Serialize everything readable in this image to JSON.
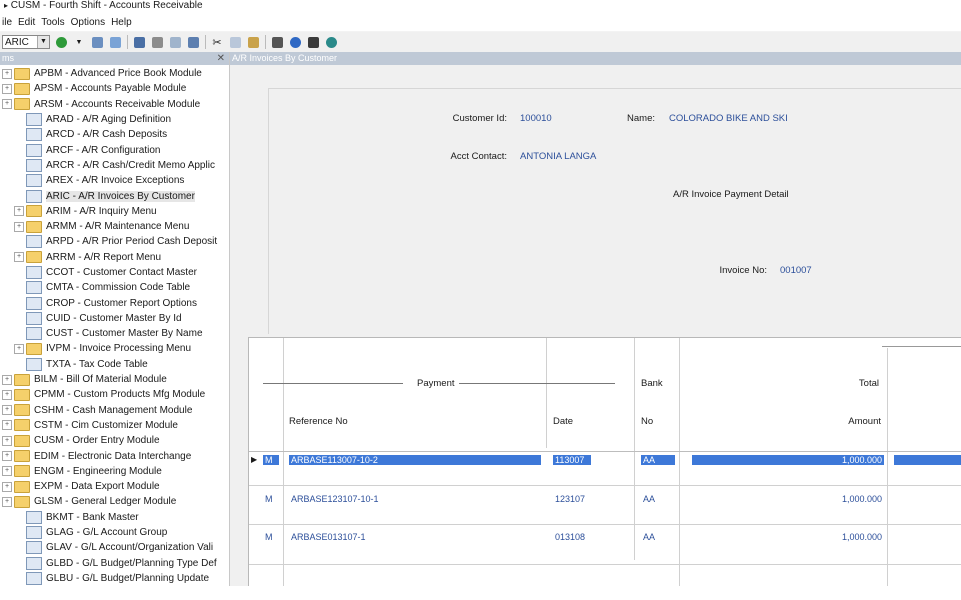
{
  "window": {
    "title": "CUSM - Fourth Shift - Accounts Receivable"
  },
  "menu": [
    "ile",
    "Edit",
    "Tools",
    "Options",
    "Help"
  ],
  "toolbar": {
    "combo_value": "ARIC"
  },
  "nav": {
    "header": "ms",
    "items": [
      {
        "label": "APBM - Advanced Price Book Module",
        "type": "folder",
        "level": 0
      },
      {
        "label": "APSM - Accounts Payable Module",
        "type": "folder",
        "level": 0
      },
      {
        "label": "ARSM - Accounts Receivable Module",
        "type": "folder",
        "level": 0
      },
      {
        "label": "ARAD - A/R Aging Definition",
        "type": "doc",
        "level": 1
      },
      {
        "label": "ARCD - A/R Cash Deposits",
        "type": "doc",
        "level": 1
      },
      {
        "label": "ARCF - A/R Configuration",
        "type": "doc",
        "level": 1
      },
      {
        "label": "ARCR - A/R Cash/Credit Memo Applic",
        "type": "doc",
        "level": 1
      },
      {
        "label": "AREX - A/R Invoice Exceptions",
        "type": "doc",
        "level": 1
      },
      {
        "label": "ARIC - A/R Invoices By Customer",
        "type": "doc",
        "level": 1,
        "selected": true
      },
      {
        "label": "ARIM - A/R Inquiry Menu",
        "type": "folder",
        "level": 1,
        "expandable": true
      },
      {
        "label": "ARMM - A/R Maintenance Menu",
        "type": "folder",
        "level": 1,
        "expandable": true
      },
      {
        "label": "ARPD - A/R Prior Period Cash Deposit",
        "type": "doc",
        "level": 1
      },
      {
        "label": "ARRM - A/R Report Menu",
        "type": "folder",
        "level": 1,
        "expandable": true
      },
      {
        "label": "CCOT - Customer Contact Master",
        "type": "doc",
        "level": 1
      },
      {
        "label": "CMTA - Commission Code Table",
        "type": "doc",
        "level": 1
      },
      {
        "label": "CROP - Customer Report Options",
        "type": "doc",
        "level": 1
      },
      {
        "label": "CUID - Customer Master By Id",
        "type": "doc",
        "level": 1
      },
      {
        "label": "CUST - Customer Master By Name",
        "type": "doc",
        "level": 1
      },
      {
        "label": "IVPM - Invoice Processing Menu",
        "type": "folder",
        "level": 1,
        "expandable": true
      },
      {
        "label": "TXTA - Tax Code Table",
        "type": "doc",
        "level": 1
      },
      {
        "label": "BILM - Bill Of Material Module",
        "type": "folder",
        "level": 0
      },
      {
        "label": "CPMM - Custom Products Mfg Module",
        "type": "folder",
        "level": 0
      },
      {
        "label": "CSHM - Cash Management Module",
        "type": "folder",
        "level": 0
      },
      {
        "label": "CSTM - Cim Customizer Module",
        "type": "folder",
        "level": 0
      },
      {
        "label": "CUSM - Order Entry Module",
        "type": "folder",
        "level": 0
      },
      {
        "label": "EDIM - Electronic Data Interchange",
        "type": "folder",
        "level": 0
      },
      {
        "label": "ENGM - Engineering Module",
        "type": "folder",
        "level": 0
      },
      {
        "label": "EXPM - Data Export Module",
        "type": "folder",
        "level": 0
      },
      {
        "label": "GLSM - General Ledger Module",
        "type": "folder",
        "level": 0
      },
      {
        "label": "BKMT - Bank Master",
        "type": "doc",
        "level": 1
      },
      {
        "label": "GLAG - G/L Account Group",
        "type": "doc",
        "level": 1
      },
      {
        "label": "GLAV - G/L Account/Organization Vali",
        "type": "doc",
        "level": 1
      },
      {
        "label": "GLBD - G/L Budget/Planning Type Def",
        "type": "doc",
        "level": 1
      },
      {
        "label": "GLBU - G/L Budget/Planning Update",
        "type": "doc",
        "level": 1
      }
    ]
  },
  "main": {
    "header": "A/R Invoices By Customer",
    "customer_id_label": "Customer Id:",
    "customer_id": "100010",
    "name_label": "Name:",
    "name": "COLORADO BIKE AND SKI",
    "acct_contact_label": "Acct Contact:",
    "acct_contact": "ANTONIA LANGA",
    "section_title": "A/R Invoice Payment Detail",
    "invoice_no_label": "Invoice No:",
    "invoice_no": "001007"
  },
  "grid": {
    "group_payment": "Payment",
    "bank_top": "Bank",
    "bank_bottom": "No",
    "total_top": "Total",
    "total_bottom": "Amount",
    "col_reference": "Reference No",
    "col_date": "Date",
    "rows": [
      {
        "flag": "M",
        "reference": "ARBASE113007-10-2",
        "date": "113007",
        "bank": "AA",
        "amount": "1,000.000"
      },
      {
        "flag": "M",
        "reference": "ARBASE123107-10-1",
        "date": "123107",
        "bank": "AA",
        "amount": "1,000.000"
      },
      {
        "flag": "M",
        "reference": "ARBASE013107-1",
        "date": "013108",
        "bank": "AA",
        "amount": "1,000.000"
      }
    ]
  }
}
